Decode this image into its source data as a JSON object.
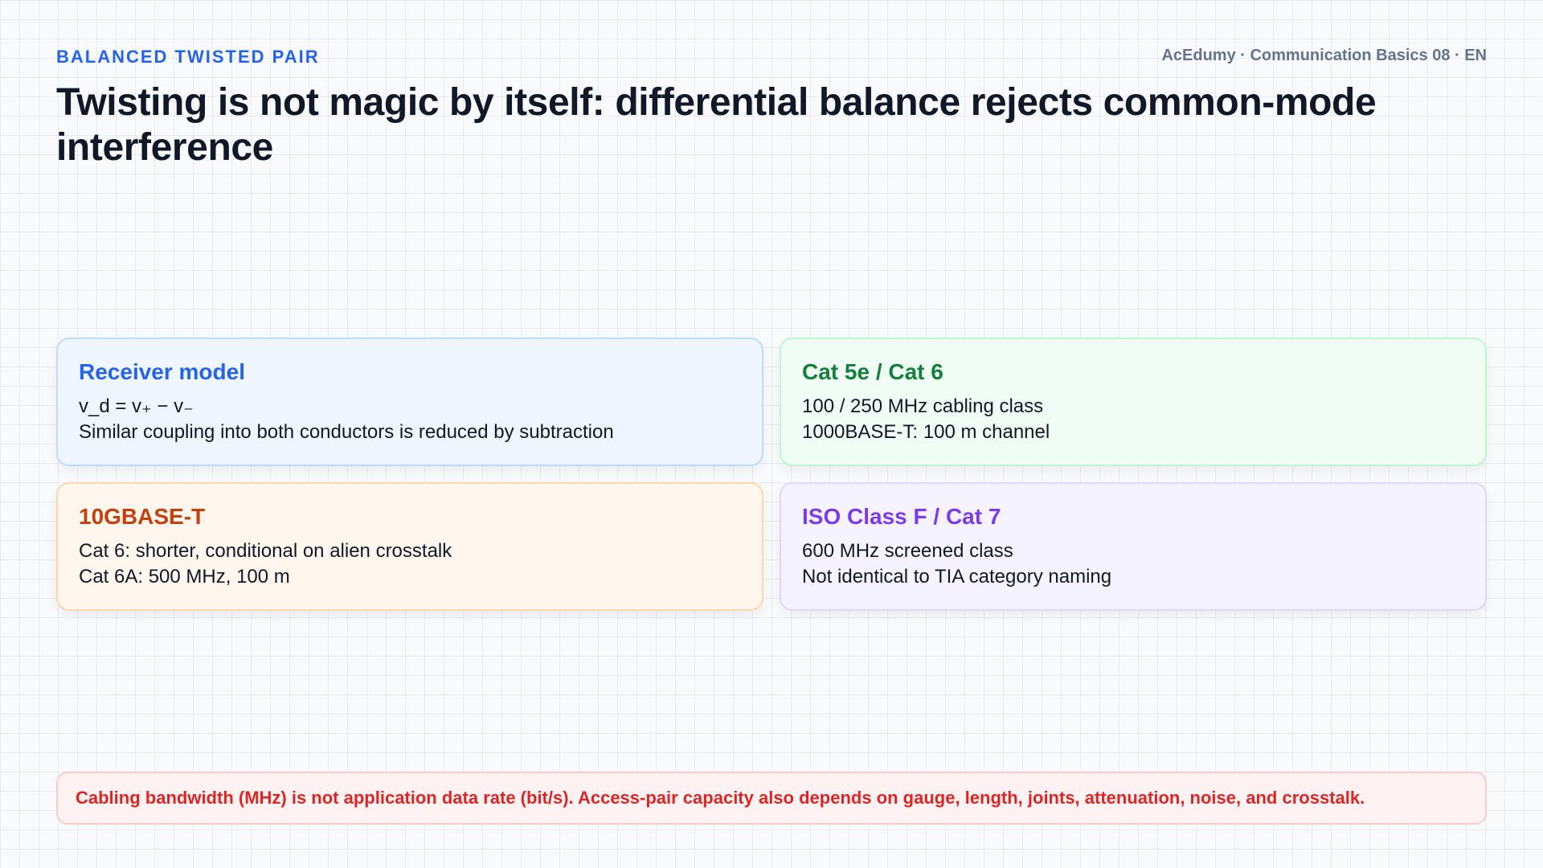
{
  "header": {
    "kicker": "BALANCED TWISTED PAIR",
    "brand": "AcEdumy · Communication Basics 08 · EN",
    "title": "Twisting is not magic by itself: differential balance rejects common-mode interference"
  },
  "cards": [
    {
      "title": "Receiver model",
      "lines": [
        "v_d = v₊ − v₋",
        "Similar coupling into both conductors is reduced by subtraction"
      ],
      "accent": "#2563eb"
    },
    {
      "title": "Cat 5e / Cat 6",
      "lines": [
        "100 / 250 MHz cabling class",
        "1000BASE-T: 100 m channel"
      ],
      "accent": "#15803d"
    },
    {
      "title": "10GBASE-T",
      "lines": [
        "Cat 6: shorter, conditional on alien crosstalk",
        "Cat 6A: 500 MHz, 100 m"
      ],
      "accent": "#c2410c"
    },
    {
      "title": "ISO Class F / Cat 7",
      "lines": [
        "600 MHz screened class",
        "Not identical to TIA category naming"
      ],
      "accent": "#7c3aed"
    }
  ],
  "footer_note": "Cabling bandwidth (MHz) is not application data rate (bit/s). Access-pair capacity also depends on gauge, length, joints, attenuation, noise, and crosstalk."
}
